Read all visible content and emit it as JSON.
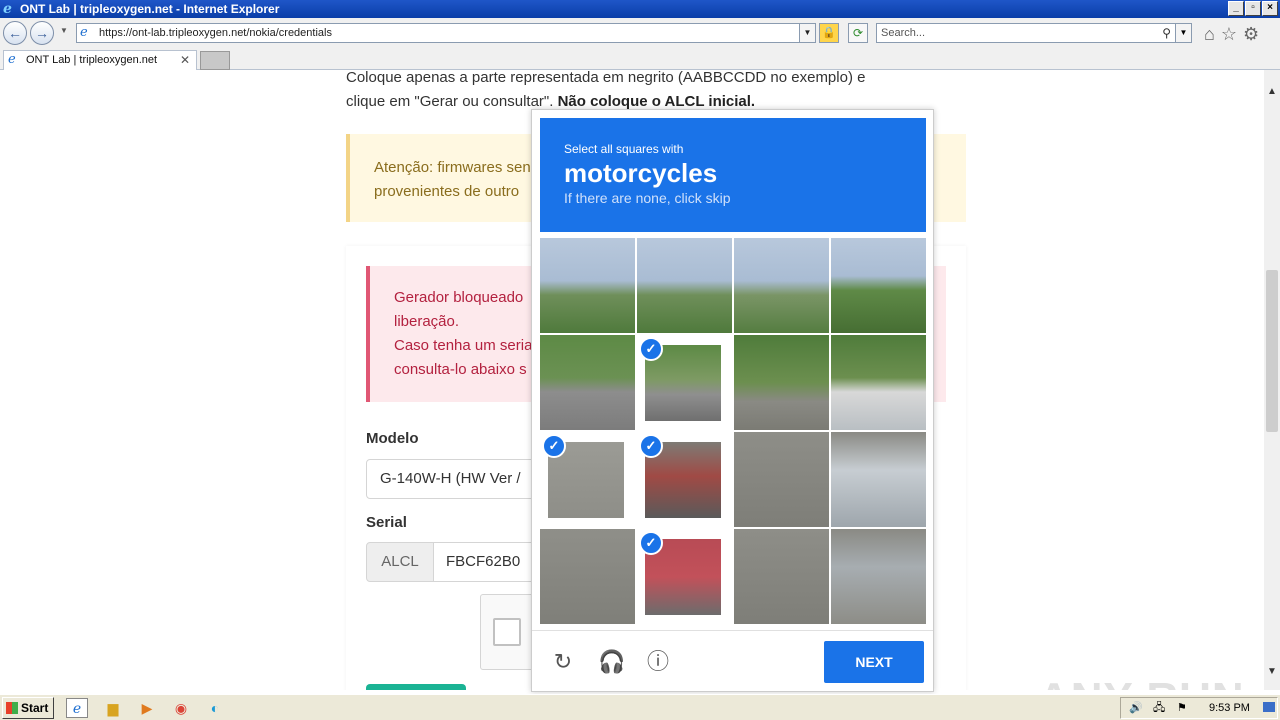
{
  "window": {
    "title": "ONT Lab | tripleoxygen.net - Internet Explorer"
  },
  "address_bar": {
    "url": "https://ont-lab.tripleoxygen.net/nokia/credentials"
  },
  "search_box": {
    "placeholder": "Search..."
  },
  "tabs": [
    {
      "label": "ONT Lab | tripleoxygen.net"
    }
  ],
  "page": {
    "intro_line1": "Coloque apenas a parte representada em negrito (AABBCCDD no exemplo) e",
    "intro_line2_plain": "clique em \"Gerar ou consultar\". ",
    "intro_line2_bold": "Não coloque o ALCL inicial.",
    "warning_line1": "Atenção: firmwares sen",
    "warning_line2": "provenientes de outro",
    "danger_line1": "Gerador bloqueado",
    "danger_line2": "liberação.",
    "danger_line3": "Caso tenha um seria",
    "danger_line4": "consulta-lo abaixo s",
    "model_label": "Modelo",
    "model_value": "G-140W-H (HW Ver /",
    "serial_label": "Serial",
    "serial_prefix": "ALCL",
    "serial_value": "FBCF62B0"
  },
  "captcha": {
    "instruction": "Select all squares with",
    "target": "motorcycles",
    "hint": "If there are none, click skip",
    "next_label": "NEXT",
    "tiles_selected": [
      false,
      false,
      false,
      false,
      false,
      true,
      false,
      false,
      true,
      true,
      false,
      false,
      false,
      true,
      false,
      false
    ],
    "colors": {
      "header": "#1a73e8",
      "check": "#1a73e8"
    }
  },
  "watermark": "ANY RUN",
  "taskbar": {
    "start_label": "Start",
    "clock": "9:53 PM"
  }
}
